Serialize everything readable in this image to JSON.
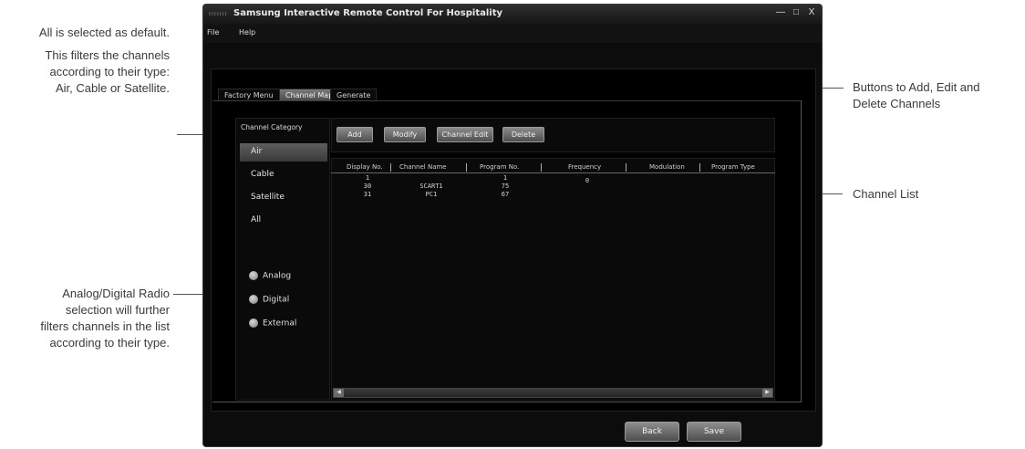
{
  "annotations": {
    "left_top_1": "All is selected as default.",
    "left_top_2": "This filters the channels",
    "left_top_3": "according to their type:",
    "left_top_4": "Air, Cable or Satellite.",
    "left_bottom_1": "Analog/Digital Radio",
    "left_bottom_2": "selection will further",
    "left_bottom_3": "filters channels in the list",
    "left_bottom_4": "according to their type.",
    "right_1_line1": "Buttons to Add, Edit and",
    "right_1_line2": "Delete Channels",
    "right_2": "Channel List"
  },
  "window": {
    "logo": "ııııııı",
    "title": "Samsung Interactive Remote Control For Hospitality",
    "controls": {
      "minimize": "—",
      "maximize": "□",
      "close": "X"
    }
  },
  "menu": {
    "file": "File",
    "help": "Help"
  },
  "tabs": {
    "factory": "Factory Menu",
    "channel_map": "Channel Map",
    "generate": "Generate"
  },
  "sidebar": {
    "title": "Channel Category",
    "categories": [
      "Air",
      "Cable",
      "Satellite",
      "All"
    ],
    "radios": [
      "Analog",
      "Digital",
      "External"
    ]
  },
  "toolbar": {
    "add": "Add",
    "modify": "Modify",
    "channel_edit": "Channel Edit",
    "delete": "Delete"
  },
  "table": {
    "columns": [
      "Display No.",
      "Channel Name",
      "Program No.",
      "Frequency",
      "Modulation",
      "Program Type"
    ],
    "rows": [
      [
        "1",
        "",
        "1",
        "0",
        "",
        ""
      ],
      [
        "30",
        "SCART1",
        "75",
        "",
        "",
        ""
      ],
      [
        "31",
        "PC1",
        "67",
        "",
        "",
        ""
      ]
    ]
  },
  "footer": {
    "back": "Back",
    "save": "Save"
  }
}
